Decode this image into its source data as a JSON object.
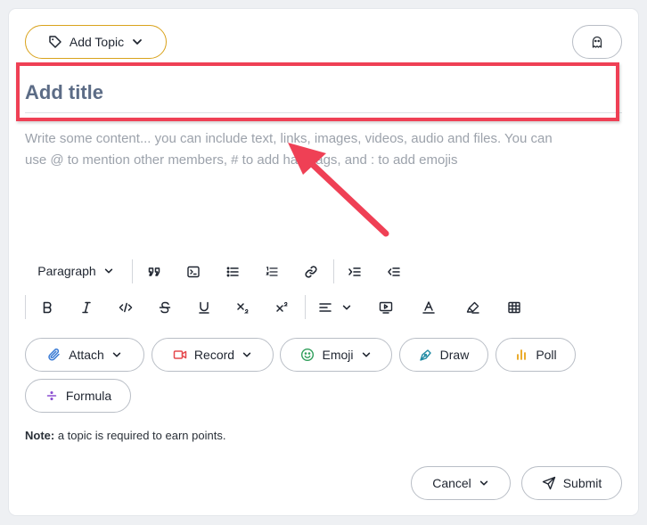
{
  "header": {
    "add_topic_label": "Add Topic",
    "icons": [
      "tag-icon",
      "chevron-down-icon",
      "ghost-icon"
    ]
  },
  "editor": {
    "title_placeholder": "Add title",
    "content_line1": "Write some content... you can include text, links, images, videos, audio and files. You can",
    "content_line2": "use @ to mention other members, # to add hashtags, and : to add emojis"
  },
  "toolbar": {
    "paragraph_label": "Paragraph",
    "row1_icons": [
      "quote-icon",
      "code-block-icon",
      "bullet-list-icon",
      "numbered-list-icon",
      "link-icon",
      "indent-icon",
      "outdent-icon"
    ],
    "row2_icons": [
      "bold-icon",
      "italic-icon",
      "inline-code-icon",
      "strikethrough-icon",
      "underline-icon",
      "subscript-icon",
      "superscript-icon",
      "align-icon",
      "embed-video-icon",
      "text-color-icon",
      "highlight-icon",
      "table-icon"
    ]
  },
  "attachments": {
    "attach_label": "Attach",
    "record_label": "Record",
    "emoji_label": "Emoji",
    "draw_label": "Draw",
    "poll_label": "Poll",
    "formula_label": "Formula"
  },
  "note": {
    "bold": "Note:",
    "text": " a topic is required to earn points."
  },
  "footer": {
    "cancel_label": "Cancel",
    "submit_label": "Submit"
  },
  "colors": {
    "topic_border": "#d9a21b",
    "annotation_red": "#ef4055",
    "title_placeholder": "#5c6c86",
    "content_placeholder": "#9ca2ab",
    "attach_icon": "#3a7bd5",
    "record_icon": "#e5484d",
    "emoji_icon": "#2f9e5a",
    "draw_icon": "#1f8aa3",
    "poll_icon": "#e8a317",
    "formula_icon": "#8b4fd1"
  }
}
